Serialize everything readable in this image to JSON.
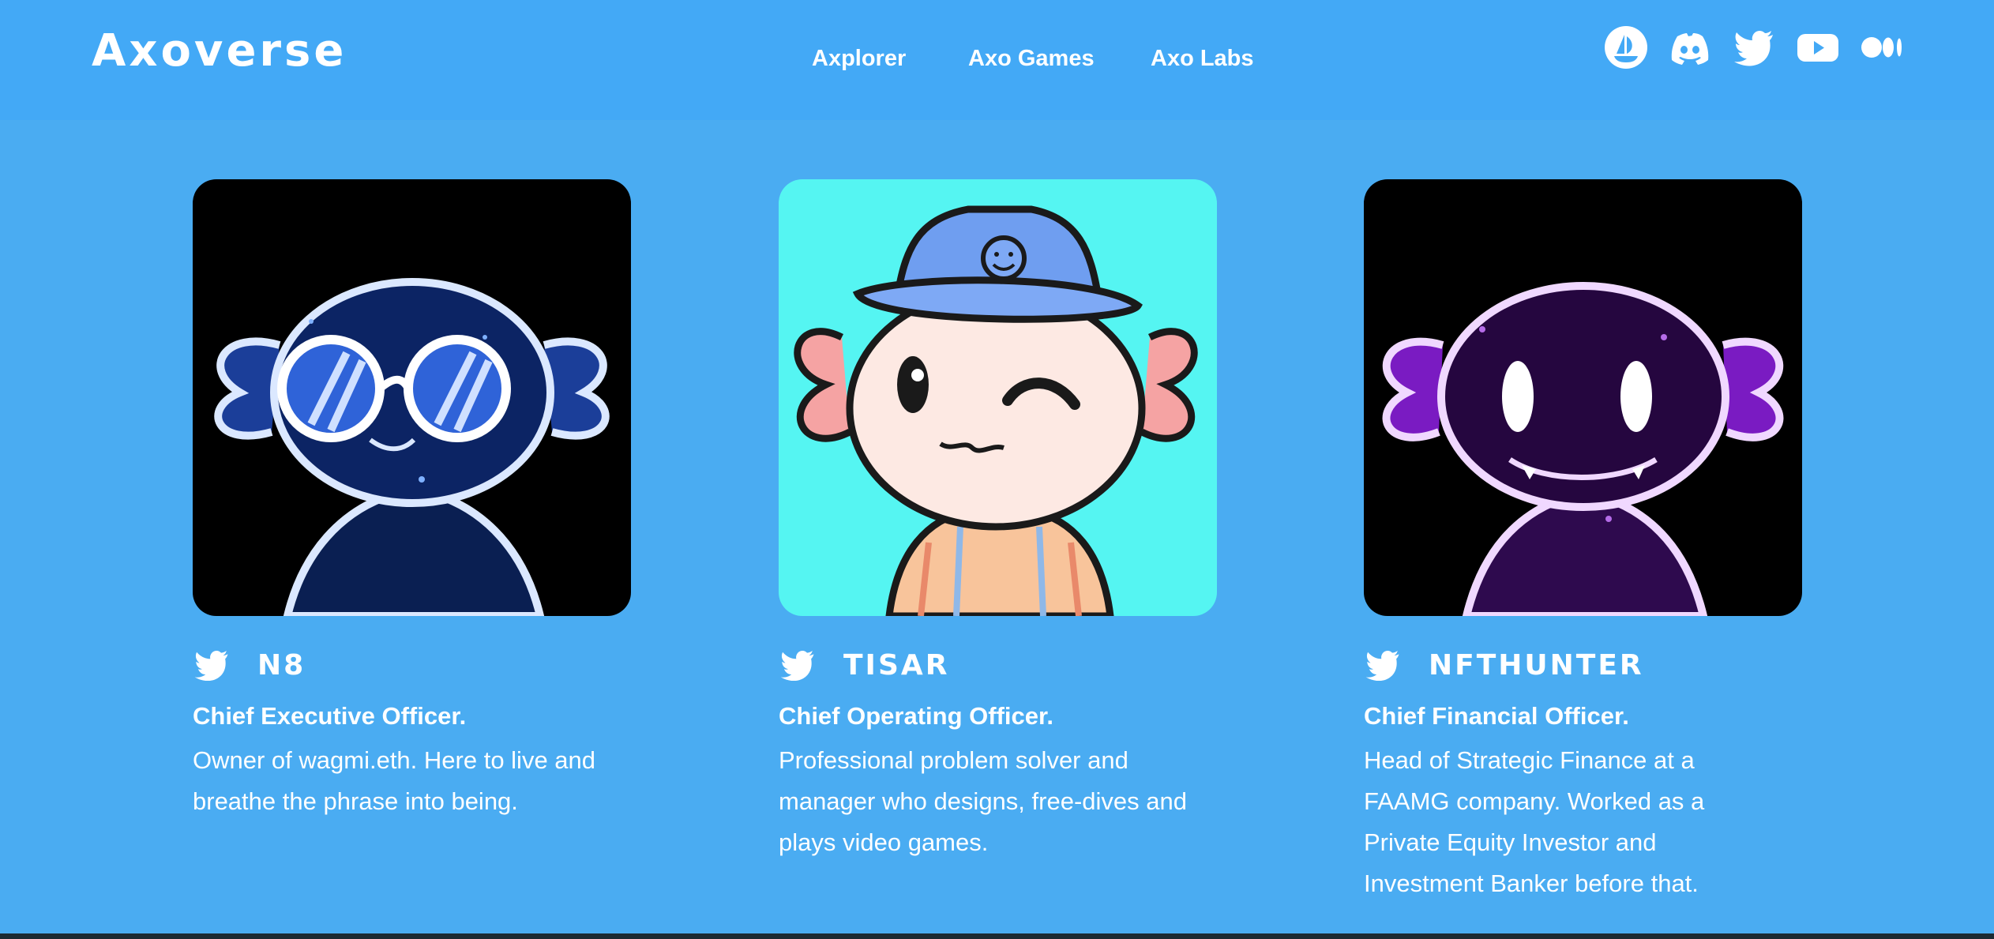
{
  "header": {
    "logo": "Axoverse",
    "nav": [
      {
        "label": "Axplorer"
      },
      {
        "label": "Axo Games"
      },
      {
        "label": "Axo Labs"
      }
    ],
    "social_icons": [
      "opensea-icon",
      "discord-icon",
      "twitter-icon",
      "youtube-icon",
      "medium-icon"
    ]
  },
  "team": [
    {
      "handle": "N8",
      "role": "Chief Executive Officer.",
      "bio": "Owner of wagmi.eth. Here to live and breathe the phrase into being.",
      "avatar_bg": "#000000",
      "avatar_color": "#0b2a6e"
    },
    {
      "handle": "TISAR",
      "role": "Chief Operating Officer.",
      "bio": "Professional problem solver and manager who designs, free-dives and plays video games.",
      "avatar_bg": "#55f5f2",
      "avatar_color": "#fde9e3"
    },
    {
      "handle": "NFTHUNTER",
      "role": "Chief Financial Officer.",
      "bio": "Head of Strategic Finance at a FAAMG company. Worked as a Private Equity Investor and Investment Banker before that.",
      "avatar_bg": "#000000",
      "avatar_color": "#3a0a5e"
    }
  ],
  "colors": {
    "header_bg": "#43a9f6",
    "page_bg": "#4aacf2",
    "text": "#ffffff"
  }
}
